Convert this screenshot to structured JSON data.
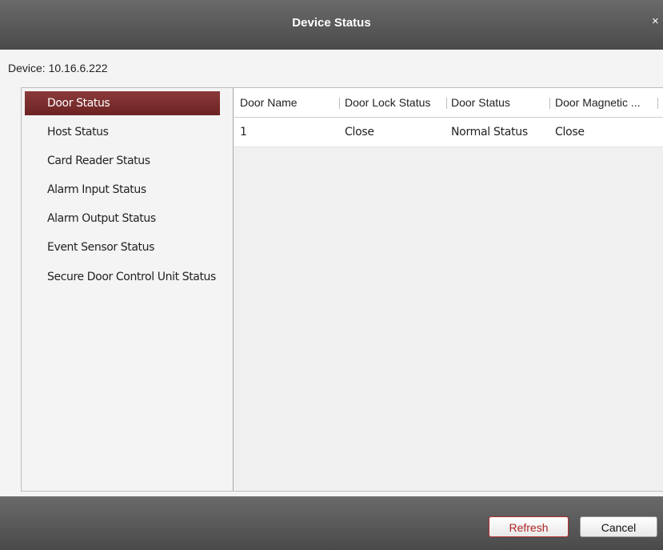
{
  "window": {
    "title": "Device Status",
    "close_glyph": "×"
  },
  "device_label": "Device: 10.16.6.222",
  "sidebar": {
    "items": [
      {
        "label": "Door Status",
        "active": true
      },
      {
        "label": "Host Status",
        "active": false
      },
      {
        "label": "Card Reader Status",
        "active": false
      },
      {
        "label": "Alarm Input Status",
        "active": false
      },
      {
        "label": "Alarm Output Status",
        "active": false
      },
      {
        "label": "Event Sensor Status",
        "active": false
      },
      {
        "label": "Secure Door Control Unit Status",
        "active": false
      }
    ]
  },
  "table": {
    "columns": [
      "Door Name",
      "Door Lock Status",
      "Door Status",
      "Door Magnetic ..."
    ],
    "rows": [
      [
        "1",
        "Close",
        "Normal Status",
        "Close"
      ]
    ]
  },
  "footer": {
    "refresh_label": "Refresh",
    "cancel_label": "Cancel"
  },
  "colors": {
    "accent": "#7a2b2b",
    "titlebar": "#5a5a5a"
  },
  "icons": {
    "close": "close-icon"
  }
}
